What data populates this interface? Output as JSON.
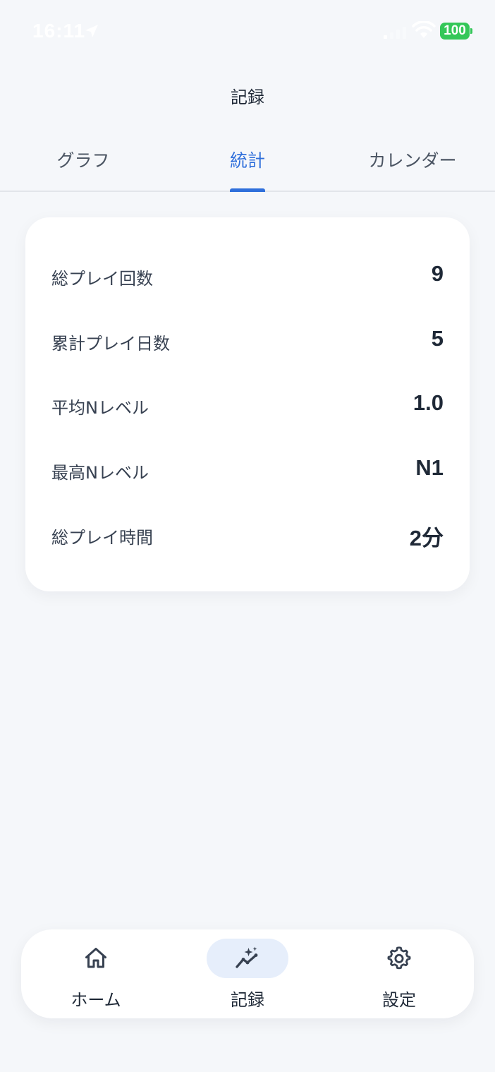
{
  "status_bar": {
    "time": "16:11",
    "battery": "100",
    "colors": {
      "battery": "#34c759"
    }
  },
  "header": {
    "title": "記録"
  },
  "tabs": [
    {
      "label": "グラフ",
      "active": false
    },
    {
      "label": "統計",
      "active": true
    },
    {
      "label": "カレンダー",
      "active": false
    }
  ],
  "stats": [
    {
      "label": "総プレイ回数",
      "value": "9"
    },
    {
      "label": "累計プレイ日数",
      "value": "5"
    },
    {
      "label": "平均Nレベル",
      "value": "1.0"
    },
    {
      "label": "最高Nレベル",
      "value": "N1"
    },
    {
      "label": "総プレイ時間",
      "value": "2分"
    }
  ],
  "bottom_nav": [
    {
      "label": "ホーム",
      "icon": "home-icon",
      "active": false
    },
    {
      "label": "記録",
      "icon": "sparkle-chart-icon",
      "active": true
    },
    {
      "label": "設定",
      "icon": "gear-icon",
      "active": false
    }
  ],
  "colors": {
    "accent": "#2f6fdb",
    "active_nav_bg": "#e6eefb",
    "background": "#f5f7fa",
    "card": "#ffffff"
  }
}
